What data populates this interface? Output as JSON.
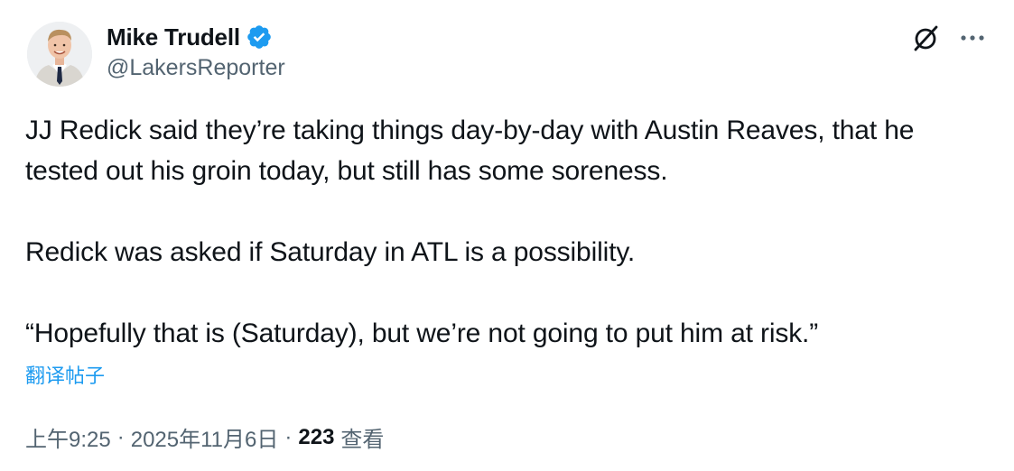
{
  "author": {
    "display_name": "Mike Trudell",
    "handle": "@LakersReporter",
    "verified": true
  },
  "icons": {
    "verified": "verified-badge-icon",
    "grok": "grok-icon",
    "more": "more-options-icon"
  },
  "tweet": {
    "paragraphs": [
      "JJ Redick said they’re taking things day-by-day with Austin Reaves, that he tested out his groin today, but still has some soreness.",
      "Redick was asked if Saturday in ATL is a possibility.",
      "“Hopefully that is (Saturday), but we’re not going to put him at risk.”"
    ],
    "translate_label": "翻译帖子"
  },
  "meta": {
    "time": "上午9:25",
    "date": "2025年11月6日",
    "separator": "·",
    "views_count": "223",
    "views_label": "查看"
  },
  "colors": {
    "text_primary": "#0f1419",
    "text_secondary": "#536471",
    "link": "#1d9bf0",
    "verified": "#1d9bf0"
  }
}
